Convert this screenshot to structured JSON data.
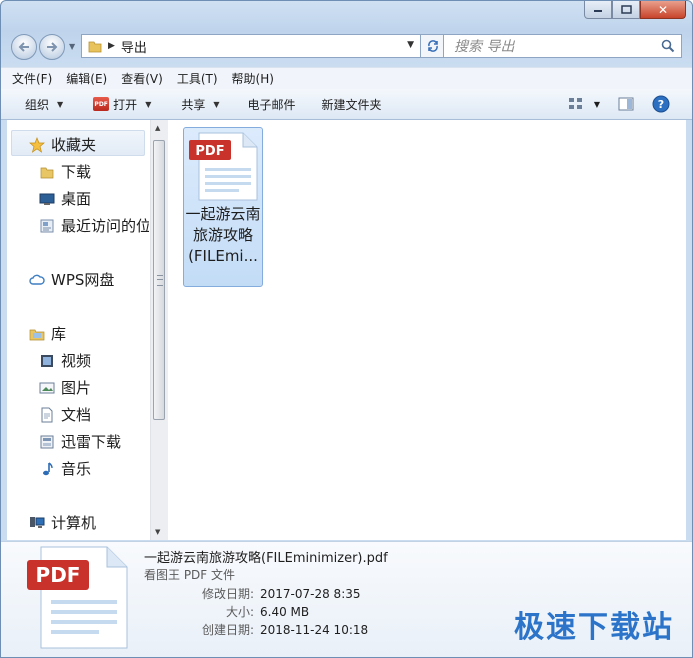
{
  "window": {
    "caption_buttons": {
      "close_symbol": "✕"
    }
  },
  "nav": {
    "back_icon": "back-arrow-icon",
    "forward_icon": "forward-arrow-icon",
    "address_segment": "导出",
    "search_placeholder": "搜索 导出"
  },
  "menu": {
    "items": [
      "文件(F)",
      "编辑(E)",
      "查看(V)",
      "工具(T)",
      "帮助(H)"
    ]
  },
  "commands": {
    "organize": "组织",
    "open": "打开",
    "share": "共享",
    "email": "电子邮件",
    "new_folder": "新建文件夹"
  },
  "sidebar": {
    "favorites": "收藏夹",
    "downloads": "下载",
    "desktop": "桌面",
    "recent": "最近访问的位置",
    "wps": "WPS网盘",
    "libraries": "库",
    "videos": "视频",
    "pictures": "图片",
    "documents": "文档",
    "thunder": "迅雷下载",
    "music": "音乐",
    "computer": "计算机"
  },
  "file": {
    "badge": "PDF",
    "name": "一起游云南旅游攻略(FILEmi..."
  },
  "details": {
    "badge": "PDF",
    "filename": "一起游云南旅游攻略(FILEminimizer).pdf",
    "type": "看图王 PDF 文件",
    "modified_label": "修改日期:",
    "modified": "2017-07-28 8:35",
    "size_label": "大小:",
    "size": "6.40 MB",
    "created_label": "创建日期:",
    "created": "2018-11-24 10:18"
  },
  "watermark": "极速下载站",
  "colors": {
    "accent": "#2b74c9",
    "pdf_red": "#c8322a",
    "selection": "#cde2f8"
  }
}
